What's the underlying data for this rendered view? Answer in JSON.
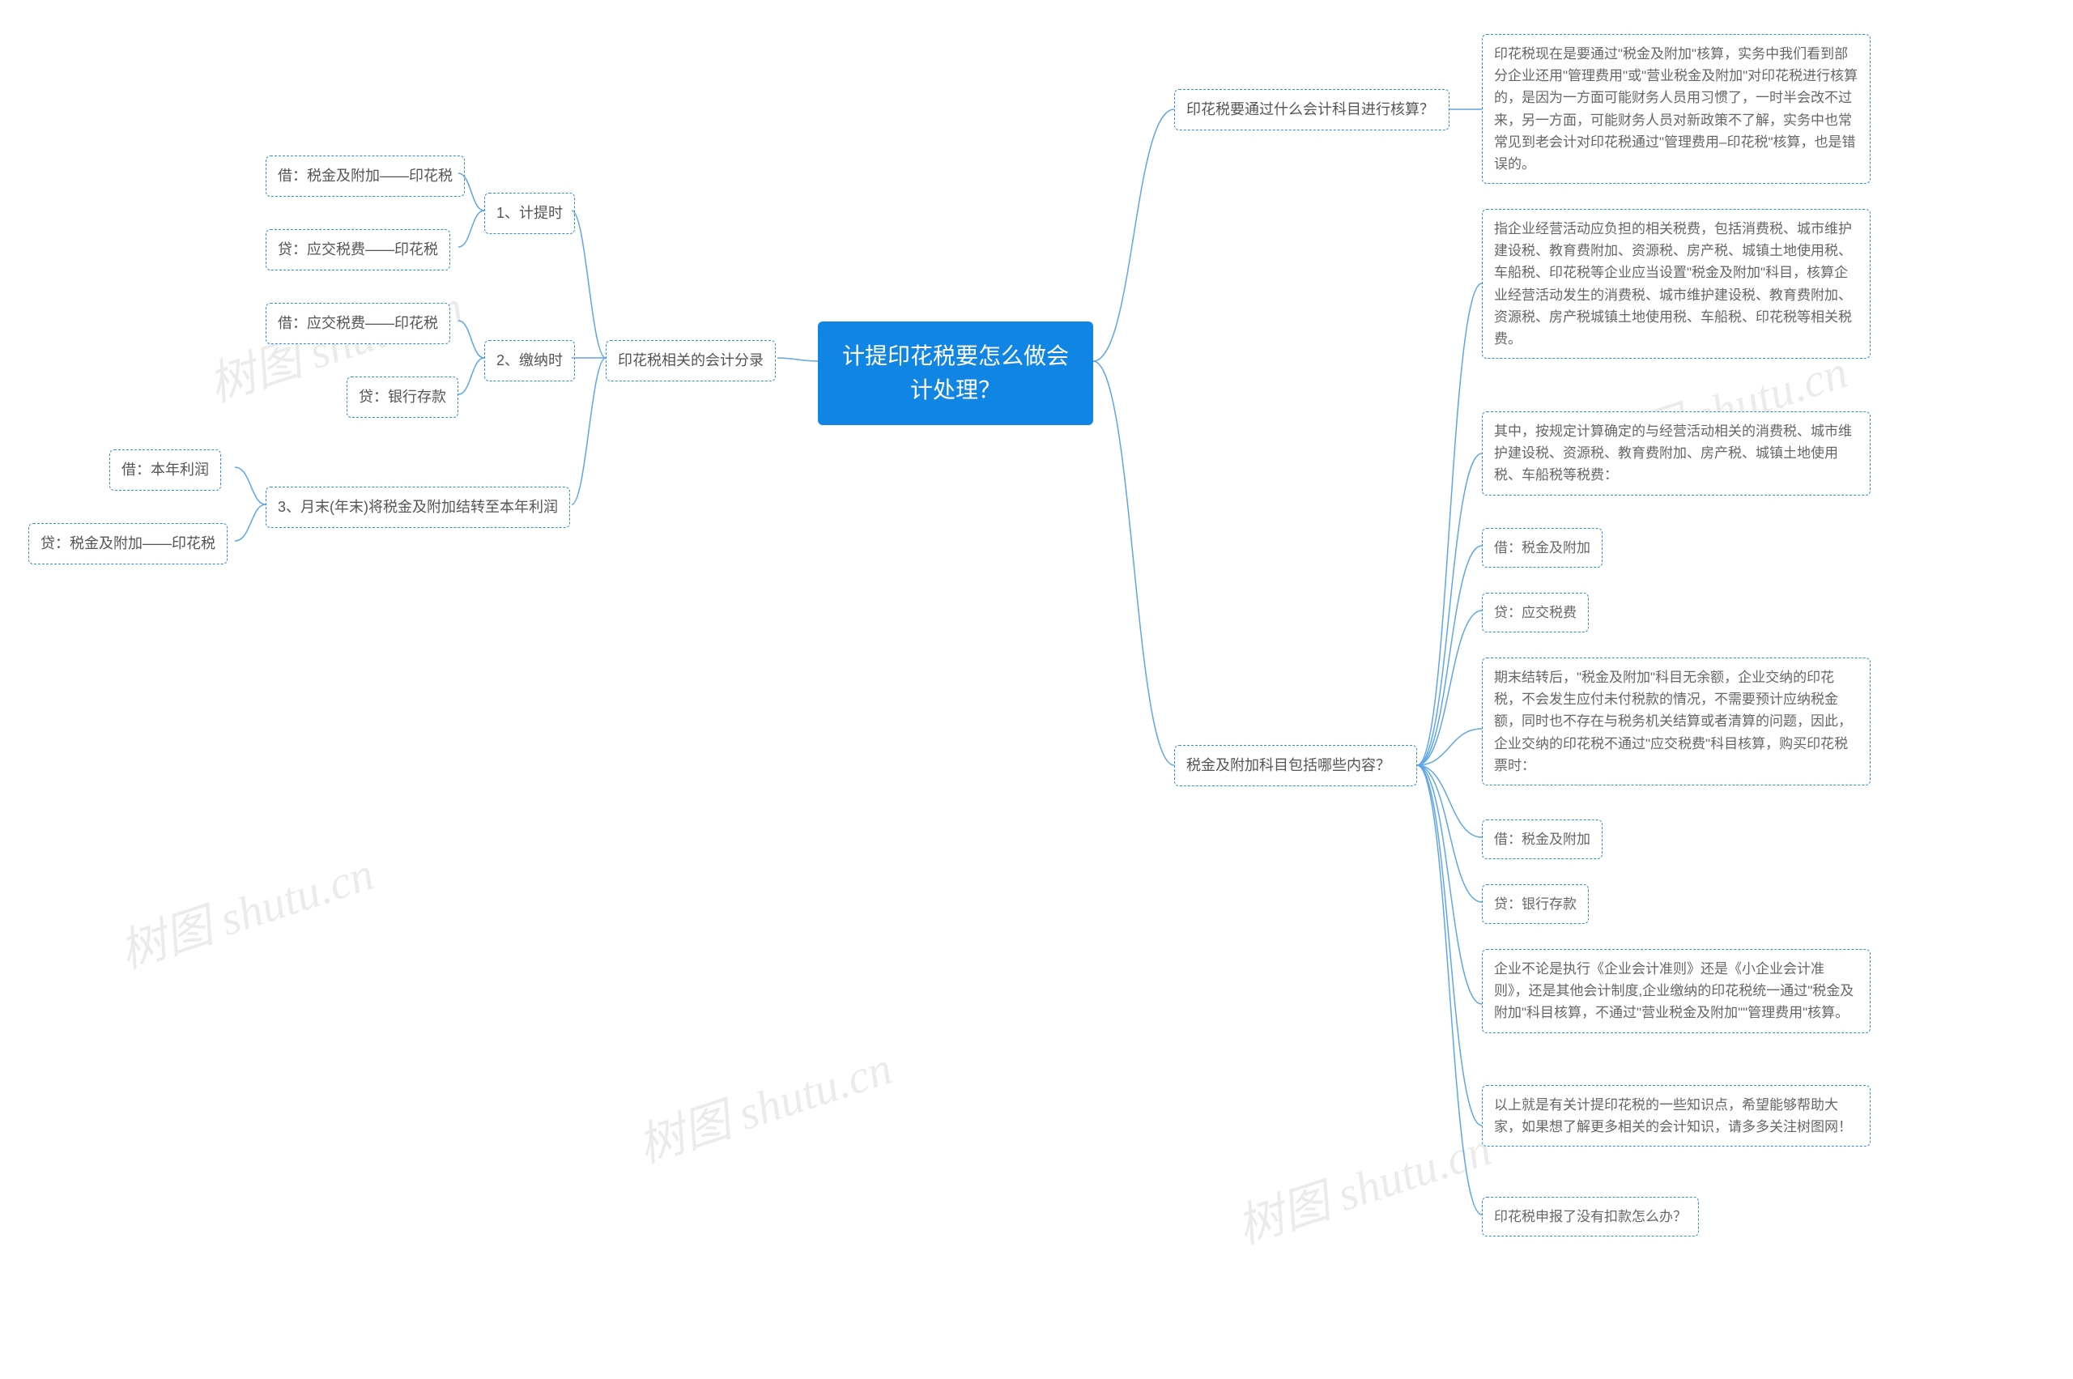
{
  "center": "计提印花税要怎么做会计处理？",
  "right": {
    "q1": {
      "label": "印花税要通过什么会计科目进行核算？",
      "ans": "印花税现在是要通过\"税金及附加\"核算，实务中我们看到部分企业还用\"管理费用\"或\"营业税金及附加\"对印花税进行核算的，是因为一方面可能财务人员用习惯了，一时半会改不过来，另一方面，可能财务人员对新政策不了解，实务中也常常见到老会计对印花税通过\"管理费用–印花税\"核算，也是错误的。"
    },
    "q2": {
      "label": "税金及附加科目包括哪些内容？",
      "items": [
        "指企业经营活动应负担的相关税费，包括消费税、城市维护建设税、教育费附加、资源税、房产税、城镇土地使用税、车船税、印花税等企业应当设置\"税金及附加\"科目，核算企业经营活动发生的消费税、城市维护建设税、教育费附加、资源税、房产税城镇土地使用税、车船税、印花税等相关税费。",
        "其中，按规定计算确定的与经营活动相关的消费税、城市维护建设税、资源税、教育费附加、房产税、城镇土地使用税、车船税等税费：",
        "借：税金及附加",
        "贷：应交税费",
        "期末结转后，\"税金及附加\"科目无余额，企业交纳的印花税，不会发生应付未付税款的情况，不需要预计应纳税金额，同时也不存在与税务机关结算或者清算的问题，因此，企业交纳的印花税不通过\"应交税费\"科目核算，购买印花税票时：",
        "借：税金及附加",
        "贷：银行存款",
        "企业不论是执行《企业会计准则》还是《小企业会计准则》，还是其他会计制度,企业缴纳的印花税统一通过\"税金及附加\"科目核算，不通过\"营业税金及附加\"\"管理费用\"核算。",
        "以上就是有关计提印花税的一些知识点，希望能够帮助大家，如果想了解更多相关的会计知识，请多多关注树图网！",
        "印花税申报了没有扣款怎么办？"
      ]
    }
  },
  "left": {
    "group": "印花税相关的会计分录",
    "items": {
      "t1": {
        "label": "1、计提时",
        "a": "借：税金及附加——印花税",
        "b": "贷：应交税费——印花税"
      },
      "t2": {
        "label": "2、缴纳时",
        "a": "借：应交税费——印花税",
        "b": "贷：银行存款"
      },
      "t3": {
        "label": "3、月末(年末)将税金及附加结转至本年利润",
        "a": "借：本年利润",
        "b": "贷：税金及附加——印花税"
      }
    }
  },
  "watermarks": [
    "树图 shutu.cn",
    "树图 shutu.cn",
    "树图 shutu.cn",
    "树图 shutu.cn",
    "树图 shutu.cn"
  ]
}
